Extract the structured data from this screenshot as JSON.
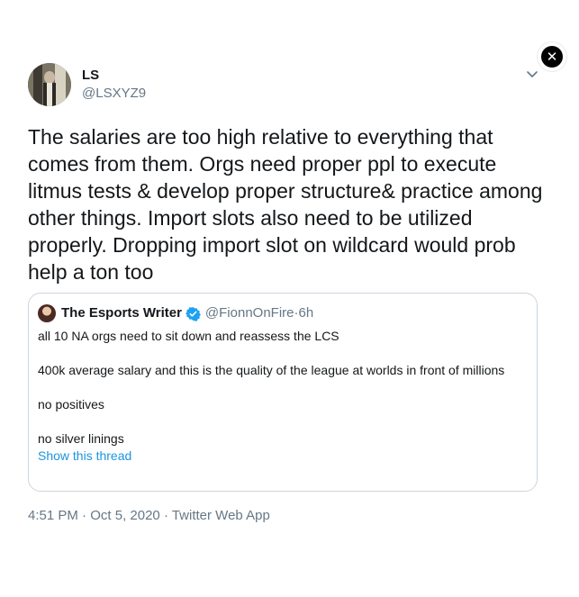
{
  "tweet": {
    "author_name": "LS",
    "author_handle": "@LSXYZ9",
    "text": "The salaries are too high relative to everything that comes from them. Orgs need proper ppl to execute litmus tests & develop proper structure& practice among other things. Import slots also need to be utilized properly. Dropping import slot on wildcard would prob help a ton too",
    "time": "4:51 PM",
    "date": "Oct 5, 2020",
    "source": "Twitter Web App",
    "separator": " · "
  },
  "quote": {
    "author_name": "The Esports Writer",
    "author_handle": "@FionnOnFire",
    "age": "6h",
    "separator": " · ",
    "paragraphs": [
      "all 10 NA orgs need to sit down and reassess the LCS",
      "400k average salary and this is the quality of the league at worlds in front of millions",
      "no positives",
      "no silver linings"
    ],
    "show_thread": "Show this thread"
  },
  "icons": {
    "close": "close-icon",
    "caret": "chevron-down-icon",
    "verified": "verified-badge-icon"
  },
  "colors": {
    "text": "#14171a",
    "secondary": "#657786",
    "link": "#1b95e0",
    "verified": "#1da1f2",
    "border": "#ccd6dd"
  }
}
